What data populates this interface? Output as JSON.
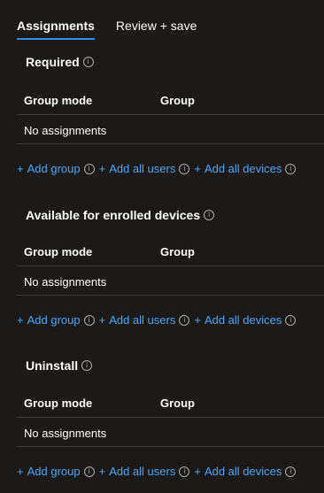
{
  "tabs": [
    {
      "label": "Assignments",
      "active": true
    },
    {
      "label": "Review + save",
      "active": false
    }
  ],
  "table_headers": {
    "group_mode": "Group mode",
    "group": "Group"
  },
  "sections": [
    {
      "title": "Required",
      "empty_text": "No assignments",
      "actions": [
        {
          "label": "Add group"
        },
        {
          "label": "Add all users"
        },
        {
          "label": "Add all devices"
        }
      ]
    },
    {
      "title": "Available for enrolled devices",
      "empty_text": "No assignments",
      "actions": [
        {
          "label": "Add group"
        },
        {
          "label": "Add all users"
        },
        {
          "label": "Add all devices"
        }
      ]
    },
    {
      "title": "Uninstall",
      "empty_text": "No assignments",
      "actions": [
        {
          "label": "Add group"
        },
        {
          "label": "Add all users"
        },
        {
          "label": "Add all devices"
        }
      ]
    }
  ],
  "icons": {
    "info": "info-icon",
    "add": "plus-icon"
  },
  "colors": {
    "background": "#1b1a19",
    "link": "#4ca5f5",
    "accent": "#2f8fea",
    "divider": "#3b3a39"
  }
}
